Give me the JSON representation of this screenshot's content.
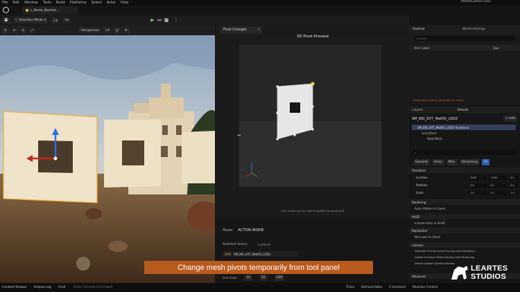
{
  "window": {
    "title": "MiddleEasternTown"
  },
  "menu": [
    "File",
    "Edit",
    "Window",
    "Tools",
    "Build",
    "Platforms",
    "Select",
    "Actor",
    "Help"
  ],
  "document_tab": "L_Iberia_Backlot_...",
  "toolbar": {
    "mode_label": "Selection Mode",
    "perspective_label": "Perspective",
    "lit_label": "Lit"
  },
  "pivot_panel": {
    "tab_label": "Pivot Changer",
    "preview_title": "3D Pivot Preview",
    "preview_hint": "Click a point on the cube to update the pivot point",
    "mode_label": "Mode:",
    "mode_value": "ACTOR MODE",
    "selected_actors_label": "Selected Actors:",
    "selected_actors_value": "1 actor(s)",
    "selected_item_tag": "[SM]",
    "selected_item": "SM_BIG_EXT_Wall05_LOD3",
    "grid_snap_label": "Grid Snap:",
    "grid_snap_values": [
      "10",
      "50",
      "100"
    ]
  },
  "outliner": {
    "tab_label": "Outliner",
    "world_settings_label": "World Settings",
    "search_placeholder": "Search...",
    "column_item_label": "Item Label",
    "column_type": "Type",
    "warning": "Some actors were not loaded in editor"
  },
  "details": {
    "layers_label": "Layers",
    "details_label": "Details",
    "object_name": "SM_BIG_EXT_Wall05_LOD3",
    "add_label": "+ Add",
    "instance_label": "SM_BIG_EXT_Wall05_LOD3 (Instance)",
    "scene_root": "SceneRoot",
    "static_mesh": "StaticMesh",
    "filter_tabs": [
      "General",
      "Actor",
      "Misc",
      "Streaming",
      "All"
    ],
    "transform": {
      "section": "Transform",
      "location_label": "Location",
      "rotation_label": "Rotation",
      "scale_label": "Scale",
      "location": [
        "3200",
        "-1200",
        "0.0"
      ],
      "rotation": [
        "0.0",
        "0.0",
        "0.0"
      ],
      "scale": [
        "1.0",
        "1.0",
        "1.0"
      ]
    },
    "sections": [
      "Rendering",
      "HLOD",
      "Replication",
      "Collision",
      "Advanced"
    ],
    "rendering_row": "Actor Hidden In Game",
    "hlod_row": "Include Actor in HLOD",
    "replication_row": "Net Load on Client",
    "collision_rows": [
      "Generate Overlap Events During Level Streaming",
      "Update Overlaps Method During Level Streaming",
      "Default Update Overlaps Method"
    ]
  },
  "caption": "Change mesh pivots temporarily from tool panel",
  "status_bar": {
    "content_drawer": "Content Drawer",
    "output_log": "Output Log",
    "cmd": "Cmd",
    "cmd_placeholder": "Enter Console Command",
    "trace": "Trace",
    "derived_data": "Derived Data",
    "unsaved": "1 Unsaved",
    "revision_control": "Revision Control"
  },
  "logo": {
    "line1": "LEARTES",
    "line2": "STUDIOS"
  }
}
